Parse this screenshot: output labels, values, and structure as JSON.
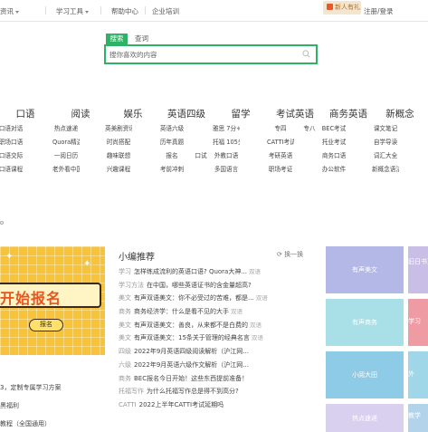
{
  "topbar": {
    "items": [
      {
        "label": "资讯",
        "caret": true
      },
      {
        "label": "学习工具",
        "caret": true
      },
      {
        "label": "帮助中心",
        "caret": false
      },
      {
        "label": "企业培训",
        "caret": false
      }
    ],
    "gift_label": "新人有礼",
    "auth": "注册/登录"
  },
  "search": {
    "tab_active": "搜索",
    "tab_inactive": "查词",
    "placeholder": "搜你喜欢的内容"
  },
  "categories": [
    {
      "title": "口语",
      "items": [
        "口语对话",
        "",
        "职场口语",
        "",
        "口语交际",
        "",
        "口语课程",
        ""
      ]
    },
    {
      "title": "阅读",
      "items": [
        "热点速递",
        "",
        "Quora精选",
        "",
        "一阅日历",
        "",
        "老外看中国",
        ""
      ]
    },
    {
      "title": "娱乐",
      "items": [
        "英美剧资讯",
        "",
        "时尚搭配",
        "",
        "趣味联想",
        "",
        "兴趣课程",
        ""
      ]
    },
    {
      "title": "英语四级",
      "items": [
        "英语六级",
        "",
        "历年真题",
        "",
        "报名",
        "口试",
        "考前冲刺",
        ""
      ]
    },
    {
      "title": "留学",
      "items": [
        "雅思 7分+",
        "",
        "托福 105分",
        "",
        "外教口语",
        "",
        "多国语言",
        ""
      ]
    },
    {
      "title": "考试英语",
      "items": [
        "专四",
        "专八",
        "CATTI考试",
        "",
        "考研英语",
        "",
        "职场考证",
        ""
      ]
    },
    {
      "title": "商务英语",
      "items": [
        "BEC考试",
        "",
        "托业考试",
        "",
        "商务口语",
        "",
        "办公软件",
        ""
      ]
    },
    {
      "title": "新概念",
      "items": [
        "课文笔记",
        "",
        "自学导读",
        "",
        "词汇大全",
        "",
        "新概念语法",
        ""
      ]
    }
  ],
  "banner": {
    "headline": "开始报名",
    "button": "报名"
  },
  "left_links": [
    "3，定制专属学习方案",
    "黑福利",
    "教程（全国通用）"
  ],
  "recommend": {
    "title": "小编推荐",
    "refresh": "换一换",
    "items": [
      {
        "tag": "学习",
        "text": "怎样练成流利的英语口语? Quora大神...",
        "en": "双语"
      },
      {
        "tag": "学习方法",
        "text": "在中国，哪些英语证书的含金量超高?",
        "en": ""
      },
      {
        "tag": "美文",
        "text": "有声双语美文：你不必受过的苦难，都是...",
        "en": "双语"
      },
      {
        "tag": "商务",
        "text": "商务经济学：什么是看不见的大手",
        "en": "双语"
      },
      {
        "tag": "美文",
        "text": "有声双语美文：善良，从来都不是白费的",
        "en": "双语"
      },
      {
        "tag": "美文",
        "text": "有声双语美文：15条关于管理的经典名言",
        "en": "双语"
      },
      {
        "tag": "四级",
        "text": "2022年9月英语四级阅读解析（沪江网...",
        "en": ""
      },
      {
        "tag": "六级",
        "text": "2022年9月英语六级作文解析（沪江网...",
        "en": ""
      },
      {
        "tag": "商务",
        "text": "BEC报名今日开始！这些东西提前准备！",
        "en": ""
      },
      {
        "tag": "托福写作",
        "text": "为什么托福写作总是得不到高分?",
        "en": ""
      },
      {
        "tag": "CATTI",
        "text": "2022上半年CATTI考试延期吗",
        "en": ""
      }
    ]
  },
  "tiles": [
    {
      "label": "有声美文",
      "color": "#b4b8e6"
    },
    {
      "label": "有声商务",
      "color": "#a9dfe6"
    },
    {
      "label": "小阅大田",
      "color": "#8ecbe6"
    },
    {
      "label": "热点速递",
      "color": "#d8d0ee"
    }
  ],
  "tiles_side": [
    {
      "label": "旧日书页",
      "color": "#c9bfe6"
    },
    {
      "label": "学习",
      "color": "#ef9ba4"
    },
    {
      "label": "外",
      "color": "#9fd7e9"
    },
    {
      "label": "教学",
      "color": "#b2d3ea"
    }
  ]
}
